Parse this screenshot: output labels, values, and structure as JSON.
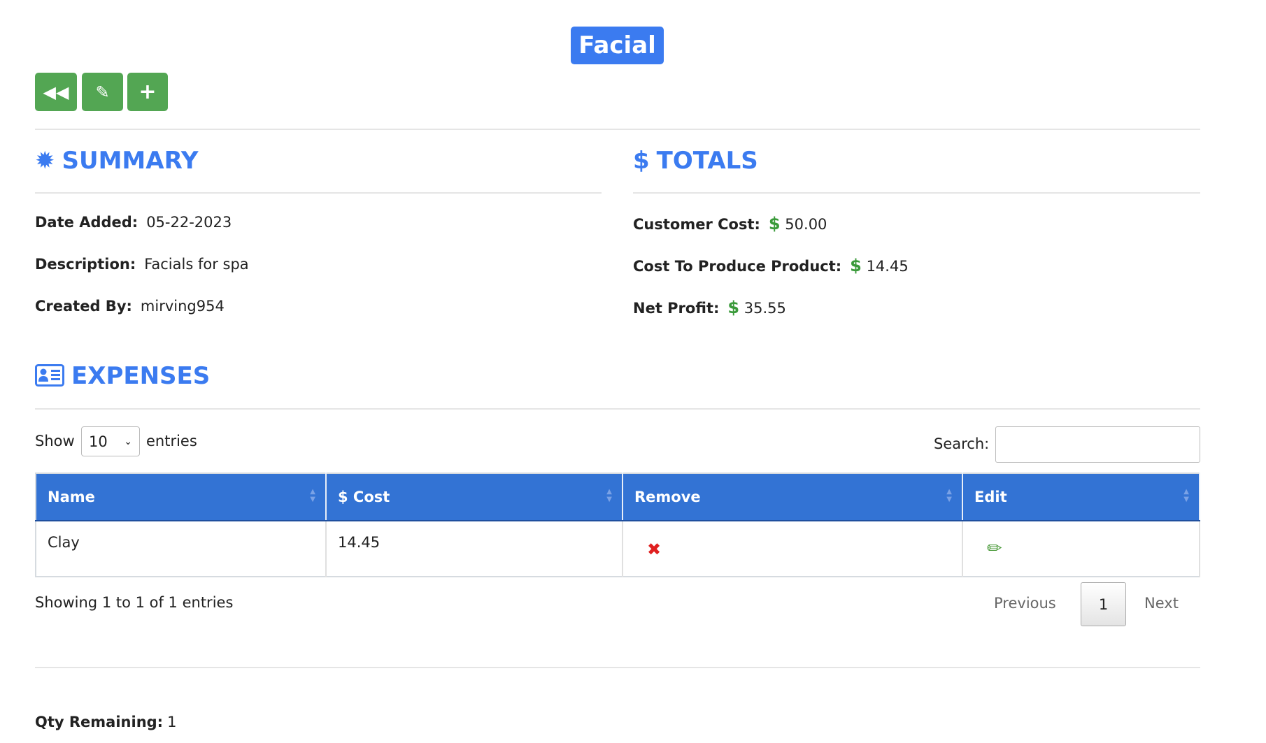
{
  "title": "Facial",
  "toolbar": {
    "back_icon": "backward-icon",
    "edit_icon": "pencil-icon",
    "add_icon": "plus-icon"
  },
  "summary": {
    "heading": "SUMMARY",
    "icon": "certificate-icon",
    "rows": [
      {
        "label": "Date Added:",
        "value": "05-22-2023"
      },
      {
        "label": "Description:",
        "value": "Facials for spa"
      },
      {
        "label": "Created By:",
        "value": "mirving954"
      }
    ]
  },
  "totals": {
    "heading": "TOTALS",
    "icon": "dollar-icon",
    "currency": "$",
    "rows": [
      {
        "label": "Customer Cost:",
        "value": "50.00"
      },
      {
        "label": "Cost To Produce Product:",
        "value": "14.45"
      },
      {
        "label": "Net Profit:",
        "value": "35.55"
      }
    ]
  },
  "expenses": {
    "heading": "EXPENSES",
    "icon": "id-card-icon",
    "show_label": "Show",
    "entries_label": "entries",
    "page_size": "10",
    "search_label": "Search:",
    "search_value": "",
    "columns": [
      "Name",
      "$ Cost",
      "Remove",
      "Edit"
    ],
    "rows": [
      {
        "name": "Clay",
        "cost": "14.45"
      }
    ],
    "info": "Showing 1 to 1 of 1 entries",
    "pagination": {
      "previous": "Previous",
      "current": "1",
      "next": "Next"
    }
  },
  "qty": {
    "label": "Qty Remaining:",
    "value": "1"
  },
  "colors": {
    "accent": "#3b7bf0",
    "header": "#3373d4",
    "button": "#53a653",
    "money": "#3a9a3a",
    "remove": "#e02020"
  }
}
